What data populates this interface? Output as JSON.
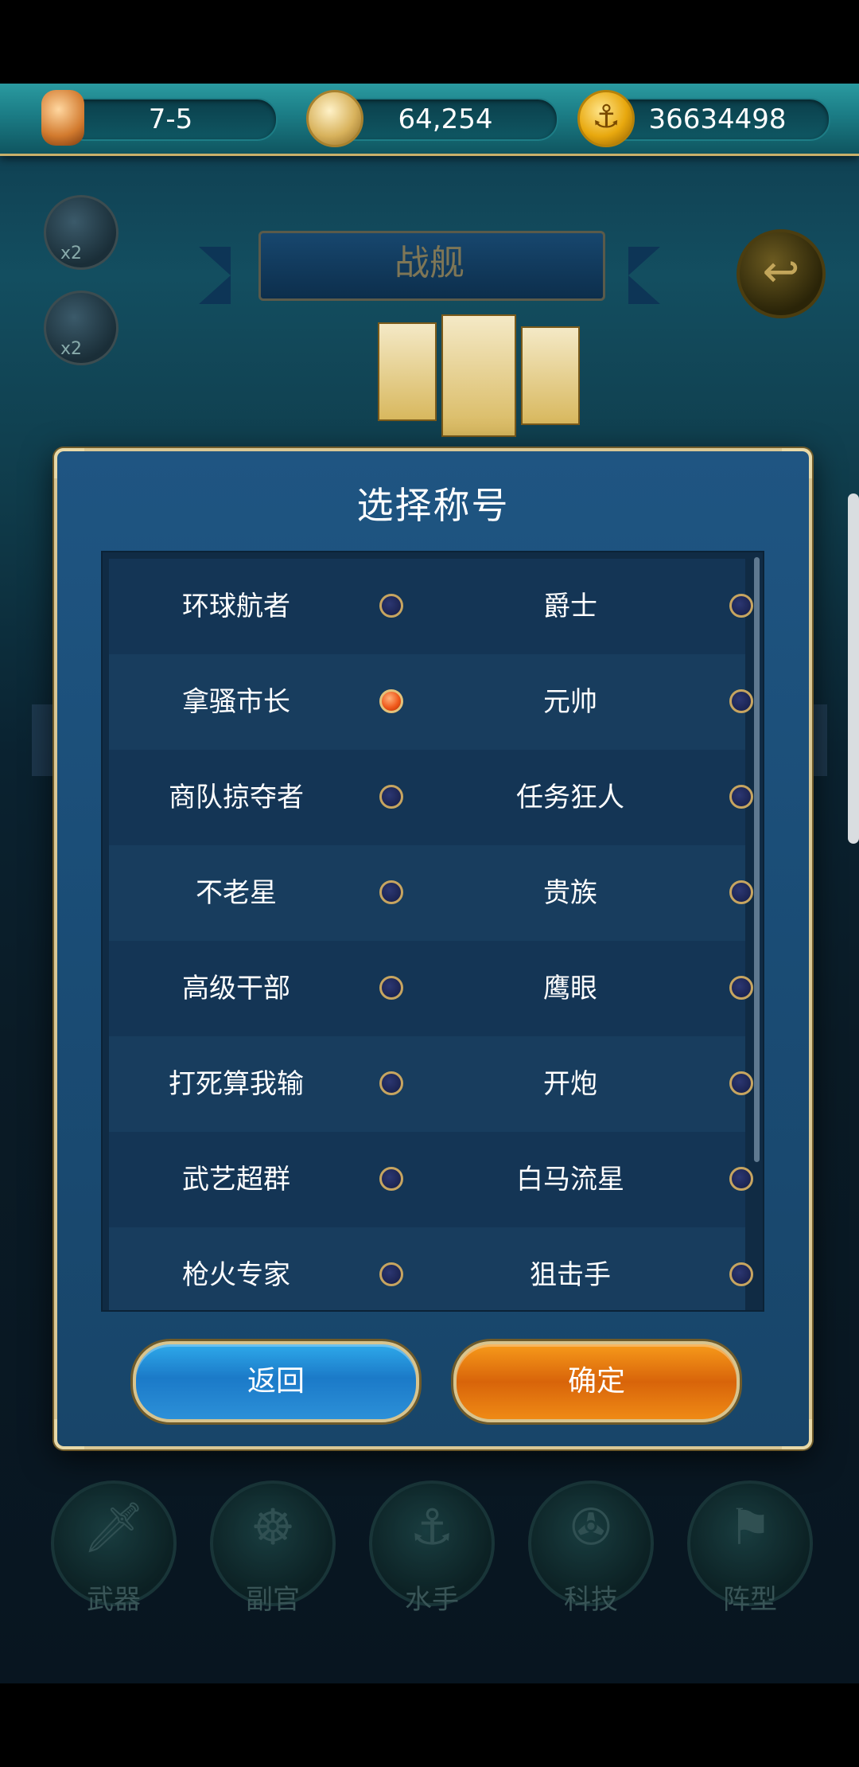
{
  "resources": {
    "stage": "7-5",
    "compass_value": "64,254",
    "gold_value": "36634498"
  },
  "page_banner": "战舰",
  "side_buttons": {
    "search_badge": "x2",
    "battle_badge": "x2"
  },
  "dialog": {
    "title": "选择称号",
    "selected_title": "拿骚市长",
    "rows": [
      {
        "left": "环球航者",
        "right": "爵士",
        "left_selected": false,
        "right_selected": false
      },
      {
        "left": "拿骚市长",
        "right": "元帅",
        "left_selected": true,
        "right_selected": false
      },
      {
        "left": "商队掠夺者",
        "right": "任务狂人",
        "left_selected": false,
        "right_selected": false
      },
      {
        "left": "不老星",
        "right": "贵族",
        "left_selected": false,
        "right_selected": false
      },
      {
        "left": "高级干部",
        "right": "鹰眼",
        "left_selected": false,
        "right_selected": false
      },
      {
        "left": "打死算我输",
        "right": "开炮",
        "left_selected": false,
        "right_selected": false
      },
      {
        "left": "武艺超群",
        "right": "白马流星",
        "left_selected": false,
        "right_selected": false
      },
      {
        "left": "枪火专家",
        "right": "狙击手",
        "left_selected": false,
        "right_selected": false
      }
    ],
    "back_label": "返回",
    "confirm_label": "确定"
  },
  "bottom_nav": [
    {
      "label": "武器",
      "icon": "sword-icon"
    },
    {
      "label": "副官",
      "icon": "helm-icon"
    },
    {
      "label": "水手",
      "icon": "hook-icon"
    },
    {
      "label": "科技",
      "icon": "compass-icon"
    },
    {
      "label": "阵型",
      "icon": "flag-icon"
    }
  ],
  "colors": {
    "dialog_bg": "#1a4c75",
    "dialog_border": "#d9c795",
    "radio_selected": "#f05a1c",
    "back_button": "#1b7ac8",
    "confirm_button": "#d8640a"
  }
}
